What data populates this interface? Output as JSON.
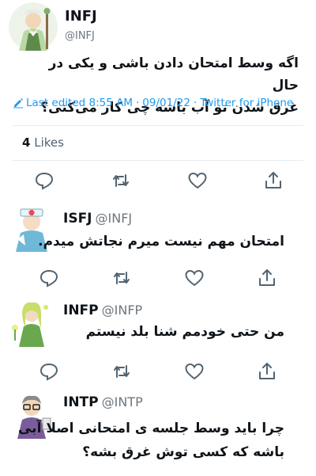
{
  "main_tweet": {
    "display_name": "INFJ",
    "handle": "@INFJ",
    "text_line1": "اگه وسط امتحان دادن باشی و یکی در حال",
    "text_line2": "غرق شدن تو آب باشه چی کار می‌کنی؟",
    "edited_label": "Last edited 8:55 AM",
    "separator": "·",
    "date": "09/01/22",
    "source": "Twitter for iPhone",
    "likes_count": "4",
    "likes_label": "Likes"
  },
  "replies": [
    {
      "display_name": "ISFJ",
      "handle": "@INFJ",
      "text": "امتحان مهم نیست میرم نجاتش میدم."
    },
    {
      "display_name": "INFP",
      "handle": "@INFP",
      "text": "من حتی خودمم شنا بلد نیستم"
    },
    {
      "display_name": "INTP",
      "handle": "@INTP",
      "text_line1": "چرا باید وسط جلسه ی امتحانی اصلا آبی",
      "text_line2": "باشه که کسی توش غرق بشه؟"
    }
  ],
  "icons": {
    "reply": "speech-bubble-icon",
    "retweet": "retweet-icon",
    "like": "heart-icon",
    "share": "share-icon",
    "edit": "pencil-icon"
  },
  "colors": {
    "link_blue": "#1d9bf0",
    "muted_gray": "#6e767d",
    "text": "#0f1419",
    "divider": "#e6ecf0"
  }
}
